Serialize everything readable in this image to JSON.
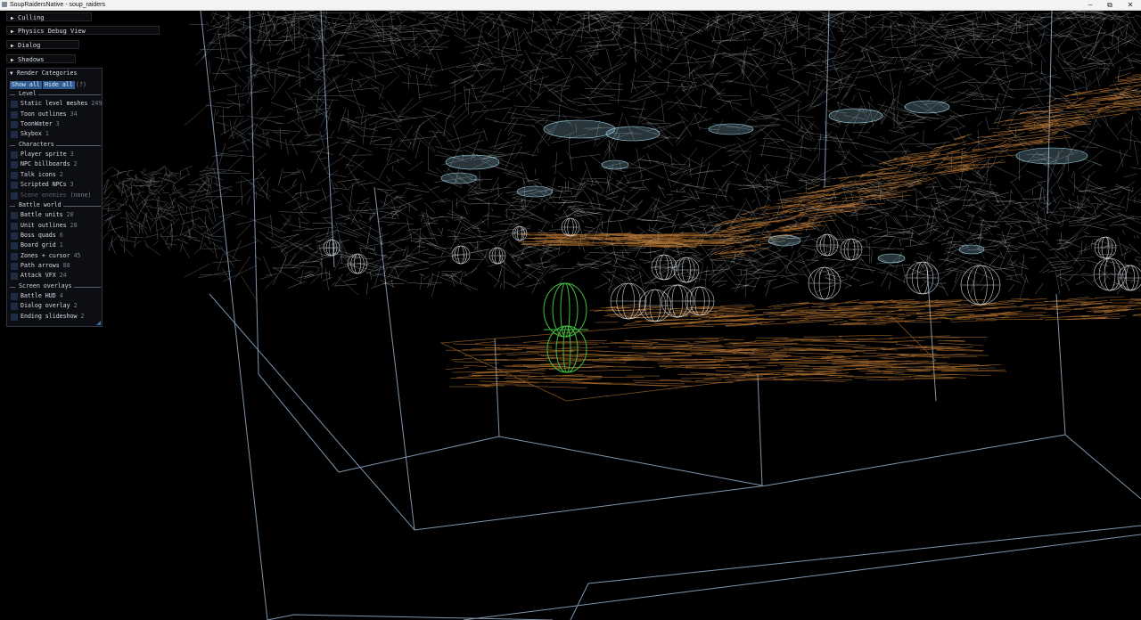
{
  "window": {
    "title": "SoupRaidersNative - soup_raiders",
    "minimize_glyph": "–",
    "maximize_glyph": "⧉",
    "close_glyph": "✕"
  },
  "headers": [
    {
      "label": "Culling",
      "arrow": "▶"
    },
    {
      "label": "Physics Debug View",
      "arrow": "▶"
    },
    {
      "label": "Dialog",
      "arrow": "▶"
    },
    {
      "label": "Shadows",
      "arrow": "▶"
    }
  ],
  "render_panel": {
    "title": "Render Categories",
    "arrow": "▼",
    "show_all": "Show all",
    "hide_all": "Hide all",
    "help": "(?)",
    "groups": [
      {
        "title": "Level",
        "items": [
          {
            "label": "Static level meshes",
            "count": "249"
          },
          {
            "label": "Toon outlines",
            "count": "34"
          },
          {
            "label": "ToonWater",
            "count": "3"
          },
          {
            "label": "Skybox",
            "count": "1"
          }
        ]
      },
      {
        "title": "Characters",
        "items": [
          {
            "label": "Player sprite",
            "count": "3"
          },
          {
            "label": "NPC billboards",
            "count": "2"
          },
          {
            "label": "Talk icons",
            "count": "2"
          },
          {
            "label": "Scripted NPCs",
            "count": "3"
          },
          {
            "label": "Scene enemies",
            "count": "(none)"
          }
        ]
      },
      {
        "title": "Battle world",
        "items": [
          {
            "label": "Battle units",
            "count": "28"
          },
          {
            "label": "Unit outlines",
            "count": "28"
          },
          {
            "label": "Boss quads",
            "count": "6"
          },
          {
            "label": "Board grid",
            "count": "1"
          },
          {
            "label": "Zones + cursor",
            "count": "45"
          },
          {
            "label": "Path arrows",
            "count": "88"
          },
          {
            "label": "Attack VFX",
            "count": "24"
          }
        ]
      },
      {
        "title": "Screen overlays",
        "items": [
          {
            "label": "Battle HUD",
            "count": "4"
          },
          {
            "label": "Dialog overlay",
            "count": "2"
          },
          {
            "label": "Ending slideshow",
            "count": "2"
          }
        ]
      }
    ]
  },
  "colors": {
    "wire_white": "#d9dde2",
    "wire_blue": "#a8c8e8",
    "wire_cyan": "#9fd8f0",
    "wire_orange": "#d98a3a",
    "wire_green": "#3fbf3f",
    "panel_bg": "#0d0f14",
    "button_bg": "#2e5c93",
    "checkbox_bg": "#1e2c43"
  }
}
